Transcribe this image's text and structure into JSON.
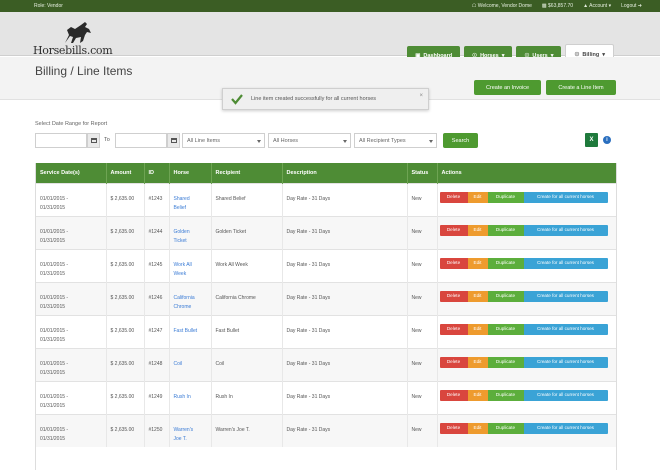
{
  "topbar": {
    "role": "Role: Vendor",
    "welcome": "Welcome, Vendor Dome",
    "balance": "$63,857.70",
    "account": "Account",
    "logout": "Logout"
  },
  "logo": {
    "text": "Horsebills.com"
  },
  "nav": {
    "dashboard": "Dashboard",
    "horses": "Horses",
    "users": "Users",
    "billing": "Billing"
  },
  "page": {
    "title": "Billing / Line Items",
    "create_invoice": "Create an Invoice",
    "create_line_item": "Create a Line Item"
  },
  "toast": {
    "message": "Line item created successfully for all current horses",
    "close": "×"
  },
  "filters": {
    "date_range_label": "Select Date Range for Report",
    "to_label": "To",
    "line_items": "All Line Items",
    "horses": "All Horses",
    "recipient_types": "All Recipient Types",
    "search": "Search"
  },
  "table": {
    "headers": [
      "Service Date(s)",
      "Amount",
      "ID",
      "Horse",
      "Recipient",
      "Description",
      "Status",
      "Actions"
    ],
    "actions": {
      "delete": "Delete",
      "edit": "Edit",
      "duplicate": "Duplicate",
      "create_all": "Create for all current horses"
    },
    "rows": [
      {
        "date": "01/01/2015 -\n01/31/2015",
        "amount": "$ 2,635.00",
        "id": "#1243",
        "horse": "Shared\nBelief",
        "recipient": "Shared Belief",
        "description": "Day Rate - 31 Days",
        "status": "New"
      },
      {
        "date": "01/01/2015 -\n01/31/2015",
        "amount": "$ 2,635.00",
        "id": "#1244",
        "horse": "Golden\nTicket",
        "recipient": "Golden Ticket",
        "description": "Day Rate - 31 Days",
        "status": "New"
      },
      {
        "date": "01/01/2015 -\n01/31/2015",
        "amount": "$ 2,635.00",
        "id": "#1245",
        "horse": "Work All\nWeek",
        "recipient": "Work All Week",
        "description": "Day Rate - 31 Days",
        "status": "New"
      },
      {
        "date": "01/01/2015 -\n01/31/2015",
        "amount": "$ 2,635.00",
        "id": "#1246",
        "horse": "California\nChrome",
        "recipient": "California Chrome",
        "description": "Day Rate - 31 Days",
        "status": "New"
      },
      {
        "date": "01/01/2015 -\n01/31/2015",
        "amount": "$ 2,635.00",
        "id": "#1247",
        "horse": "Fast Bullet",
        "recipient": "Fast Bullet",
        "description": "Day Rate - 31 Days",
        "status": "New"
      },
      {
        "date": "01/01/2015 -\n01/31/2015",
        "amount": "$ 2,635.00",
        "id": "#1248",
        "horse": "Coil",
        "recipient": "Coil",
        "description": "Day Rate - 31 Days",
        "status": "New"
      },
      {
        "date": "01/01/2015 -\n01/31/2015",
        "amount": "$ 2,635.00",
        "id": "#1249",
        "horse": "Rush In",
        "recipient": "Rush In",
        "description": "Day Rate - 31 Days",
        "status": "New"
      },
      {
        "date": "01/01/2015 -\n01/31/2015",
        "amount": "$ 2,635.00",
        "id": "#1250",
        "horse": "Warren's\nJoe T.",
        "recipient": "Warren's Joe T.",
        "description": "Day Rate - 31 Days",
        "status": "New"
      }
    ]
  },
  "colors": {
    "brand_green": "#4e8c35",
    "top_green": "#3b5d24",
    "delete": "#d9463e",
    "edit": "#ee9b2e",
    "duplicate": "#5cae3c",
    "create_all": "#3aa3d6"
  }
}
